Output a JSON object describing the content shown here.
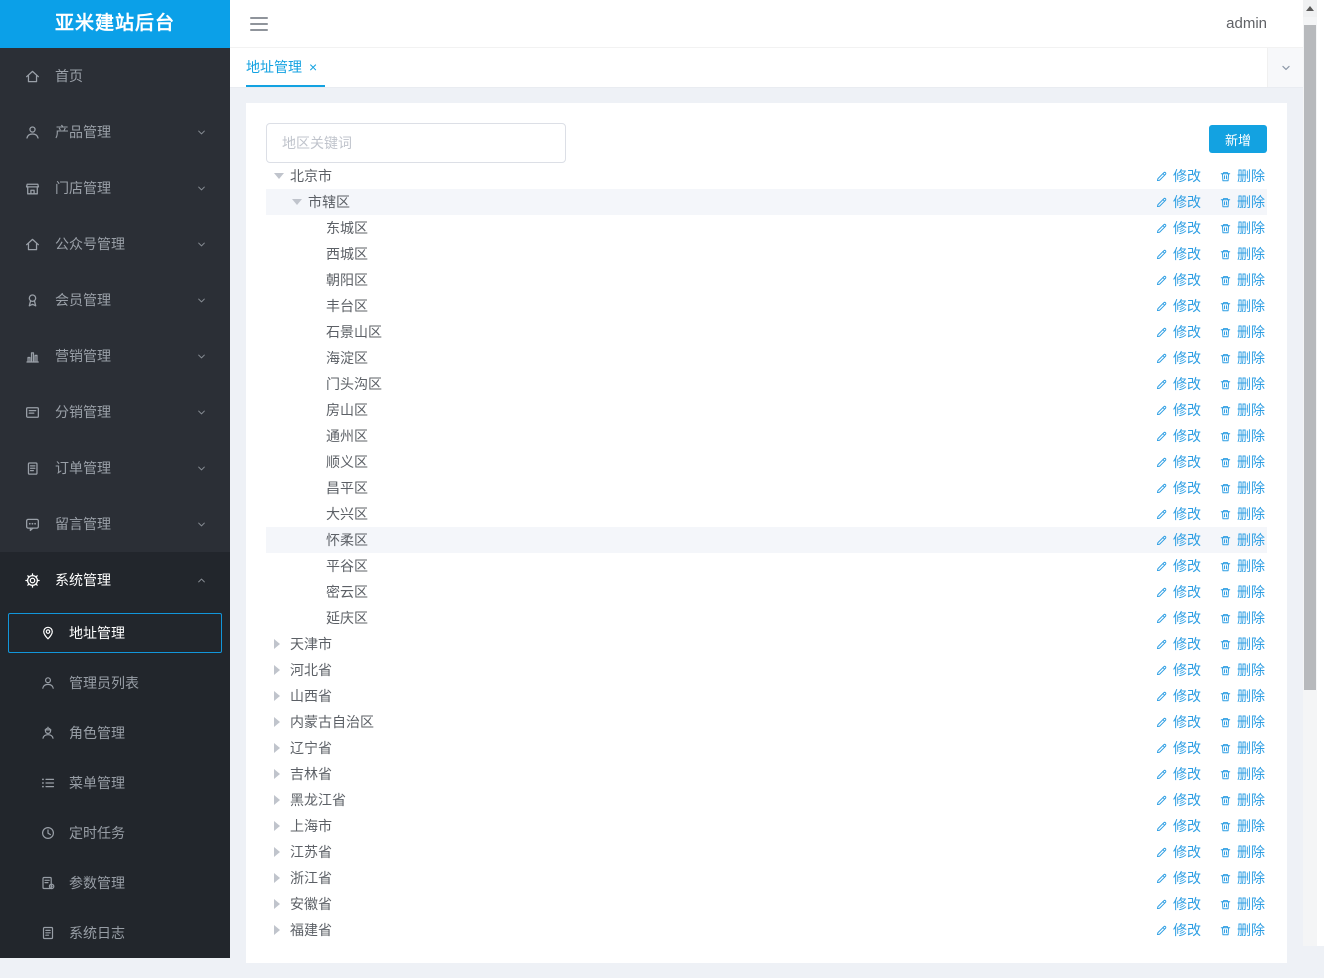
{
  "app": {
    "logo": "亚米建站后台"
  },
  "header": {
    "user": "admin"
  },
  "tabs": {
    "active_label": "地址管理",
    "close_glyph": "×"
  },
  "toolbar": {
    "search_placeholder": "地区关键词",
    "search_value": "",
    "add_label": "新增"
  },
  "colors": {
    "primary": "#13a2e1",
    "logo_bg": "#0ba0e8",
    "sidebar_bg": "#2b2f36",
    "sidebar_section_bg": "#22262c",
    "selected_border": "#1296db",
    "row_highlight": "#f4f6fa",
    "content_bg": "#eef1f6",
    "action_link": "#2d9ee3"
  },
  "sidebar": {
    "items": [
      {
        "name": "home",
        "label": "首页",
        "icon": "home",
        "chevron": null
      },
      {
        "name": "product",
        "label": "产品管理",
        "icon": "user",
        "chevron": "down"
      },
      {
        "name": "store",
        "label": "门店管理",
        "icon": "shop",
        "chevron": "down"
      },
      {
        "name": "official-account",
        "label": "公众号管理",
        "icon": "home",
        "chevron": "down"
      },
      {
        "name": "member",
        "label": "会员管理",
        "icon": "badge",
        "chevron": "down"
      },
      {
        "name": "marketing",
        "label": "营销管理",
        "icon": "bar-chart",
        "chevron": "down"
      },
      {
        "name": "distribution",
        "label": "分销管理",
        "icon": "card",
        "chevron": "down"
      },
      {
        "name": "order",
        "label": "订单管理",
        "icon": "order-doc",
        "chevron": "down"
      },
      {
        "name": "message",
        "label": "留言管理",
        "icon": "message",
        "chevron": "down"
      },
      {
        "name": "system",
        "label": "系统管理",
        "icon": "gear",
        "chevron": "up",
        "active": true,
        "children": [
          {
            "name": "address",
            "label": "地址管理",
            "icon": "location-pin",
            "selected": true
          },
          {
            "name": "admin-list",
            "label": "管理员列表",
            "icon": "user"
          },
          {
            "name": "role",
            "label": "角色管理",
            "icon": "role-user"
          },
          {
            "name": "menu",
            "label": "菜单管理",
            "icon": "menu-list"
          },
          {
            "name": "cron",
            "label": "定时任务",
            "icon": "clock"
          },
          {
            "name": "param",
            "label": "参数管理",
            "icon": "param-doc"
          },
          {
            "name": "log",
            "label": "系统日志",
            "icon": "log-doc"
          }
        ]
      }
    ]
  },
  "tree": {
    "edit_label": "修改",
    "delete_label": "删除",
    "rows": [
      {
        "label": "北京市",
        "level": 0,
        "state": "expanded",
        "highlighted": false
      },
      {
        "label": "市辖区",
        "level": 1,
        "state": "expanded",
        "highlighted": true
      },
      {
        "label": "东城区",
        "level": 2,
        "state": "leaf",
        "highlighted": false
      },
      {
        "label": "西城区",
        "level": 2,
        "state": "leaf",
        "highlighted": false
      },
      {
        "label": "朝阳区",
        "level": 2,
        "state": "leaf",
        "highlighted": false
      },
      {
        "label": "丰台区",
        "level": 2,
        "state": "leaf",
        "highlighted": false
      },
      {
        "label": "石景山区",
        "level": 2,
        "state": "leaf",
        "highlighted": false
      },
      {
        "label": "海淀区",
        "level": 2,
        "state": "leaf",
        "highlighted": false
      },
      {
        "label": "门头沟区",
        "level": 2,
        "state": "leaf",
        "highlighted": false
      },
      {
        "label": "房山区",
        "level": 2,
        "state": "leaf",
        "highlighted": false
      },
      {
        "label": "通州区",
        "level": 2,
        "state": "leaf",
        "highlighted": false
      },
      {
        "label": "顺义区",
        "level": 2,
        "state": "leaf",
        "highlighted": false
      },
      {
        "label": "昌平区",
        "level": 2,
        "state": "leaf",
        "highlighted": false
      },
      {
        "label": "大兴区",
        "level": 2,
        "state": "leaf",
        "highlighted": false
      },
      {
        "label": "怀柔区",
        "level": 2,
        "state": "leaf",
        "highlighted": true
      },
      {
        "label": "平谷区",
        "level": 2,
        "state": "leaf",
        "highlighted": false
      },
      {
        "label": "密云区",
        "level": 2,
        "state": "leaf",
        "highlighted": false
      },
      {
        "label": "延庆区",
        "level": 2,
        "state": "leaf",
        "highlighted": false
      },
      {
        "label": "天津市",
        "level": 0,
        "state": "collapsed",
        "highlighted": false
      },
      {
        "label": "河北省",
        "level": 0,
        "state": "collapsed",
        "highlighted": false
      },
      {
        "label": "山西省",
        "level": 0,
        "state": "collapsed",
        "highlighted": false
      },
      {
        "label": "内蒙古自治区",
        "level": 0,
        "state": "collapsed",
        "highlighted": false
      },
      {
        "label": "辽宁省",
        "level": 0,
        "state": "collapsed",
        "highlighted": false
      },
      {
        "label": "吉林省",
        "level": 0,
        "state": "collapsed",
        "highlighted": false
      },
      {
        "label": "黑龙江省",
        "level": 0,
        "state": "collapsed",
        "highlighted": false
      },
      {
        "label": "上海市",
        "level": 0,
        "state": "collapsed",
        "highlighted": false
      },
      {
        "label": "江苏省",
        "level": 0,
        "state": "collapsed",
        "highlighted": false
      },
      {
        "label": "浙江省",
        "level": 0,
        "state": "collapsed",
        "highlighted": false
      },
      {
        "label": "安徽省",
        "level": 0,
        "state": "collapsed",
        "highlighted": false
      },
      {
        "label": "福建省",
        "level": 0,
        "state": "collapsed",
        "highlighted": false
      }
    ]
  }
}
